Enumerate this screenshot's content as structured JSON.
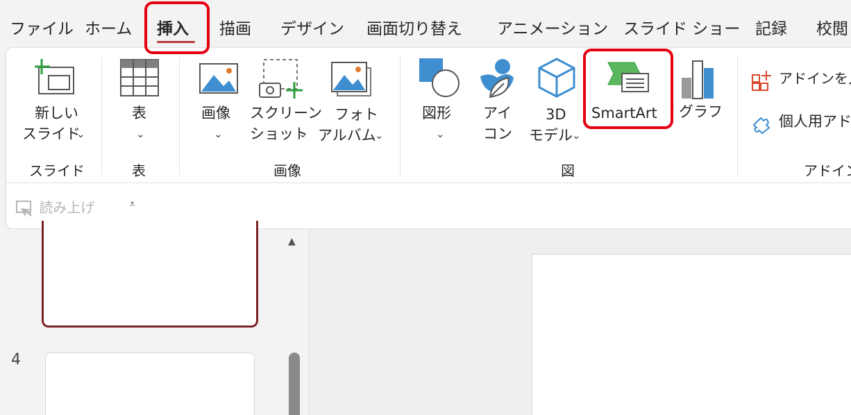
{
  "tabs": [
    "ファイル",
    "ホーム",
    "挿入",
    "描画",
    "デザイン",
    "画面切り替え",
    "アニメーション",
    "スライド ショー",
    "記録",
    "校閲"
  ],
  "ribbon": {
    "new_slide": [
      "新しい",
      "スライド"
    ],
    "table": "表",
    "image": "画像",
    "screenshot": [
      "スクリーン",
      "ショット"
    ],
    "photo_album": [
      "フォト",
      "アルバム"
    ],
    "shapes": "図形",
    "icons": [
      "アイ",
      "コン"
    ],
    "model3d": [
      "3D",
      "モデル"
    ],
    "smartart": "SmartArt",
    "chart": "グラフ",
    "addin_get": "アドインを入",
    "personal_addin": "個人用アド"
  },
  "groups": {
    "slides": "スライド",
    "tables": "表",
    "images": "画像",
    "illustrations": "図",
    "addins": "アドイン"
  },
  "qat": {
    "read_aloud": "読み上げ"
  },
  "thumbnails": {
    "slide_number": "4"
  },
  "colors": {
    "active_tab_underline": "#b3373f",
    "highlight": "#e50012",
    "selected_thumb_border": "#7a2228"
  }
}
